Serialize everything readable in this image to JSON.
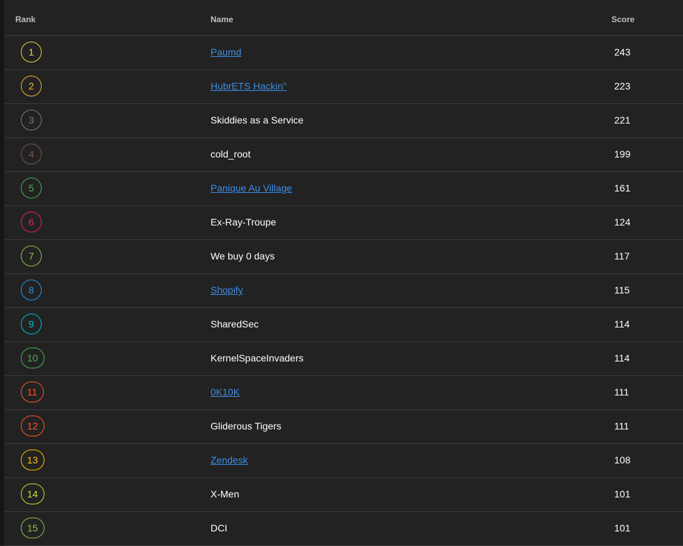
{
  "columns": {
    "rank": "Rank",
    "name": "Name",
    "score": "Score"
  },
  "rows": [
    {
      "rank": "1",
      "name": "Paumd",
      "score": "243",
      "link": true,
      "color": "#f2d23a"
    },
    {
      "rank": "2",
      "name": "HubrETS Hackin''",
      "score": "223",
      "link": true,
      "color": "#f5b731"
    },
    {
      "rank": "3",
      "name": "Skiddies as a Service",
      "score": "221",
      "link": false,
      "color": "#6f7e8c"
    },
    {
      "rank": "4",
      "name": "cold_root",
      "score": "199",
      "link": false,
      "color": "#7a5548"
    },
    {
      "rank": "5",
      "name": "Panique Au Village",
      "score": "161",
      "link": true,
      "color": "#4caf50"
    },
    {
      "rank": "6",
      "name": "Ex-Ray-Troupe",
      "score": "124",
      "link": false,
      "color": "#e91e63"
    },
    {
      "rank": "7",
      "name": "We buy 0 days",
      "score": "117",
      "link": false,
      "color": "#8bc34a"
    },
    {
      "rank": "8",
      "name": "Shopify",
      "score": "115",
      "link": true,
      "color": "#2196f3"
    },
    {
      "rank": "9",
      "name": "SharedSec",
      "score": "114",
      "link": false,
      "color": "#00bcd4"
    },
    {
      "rank": "10",
      "name": "KernelSpaceInvaders",
      "score": "114",
      "link": false,
      "color": "#4caf50"
    },
    {
      "rank": "11",
      "name": "0K10K",
      "score": "111",
      "link": true,
      "color": "#ff5722"
    },
    {
      "rank": "12",
      "name": "Gliderous Tigers",
      "score": "111",
      "link": false,
      "color": "#ff5722"
    },
    {
      "rank": "13",
      "name": "Zendesk",
      "score": "108",
      "link": true,
      "color": "#ffc107"
    },
    {
      "rank": "14",
      "name": "X-Men",
      "score": "101",
      "link": false,
      "color": "#cddc39"
    },
    {
      "rank": "15",
      "name": "DCI",
      "score": "101",
      "link": false,
      "color": "#8bc34a"
    }
  ]
}
